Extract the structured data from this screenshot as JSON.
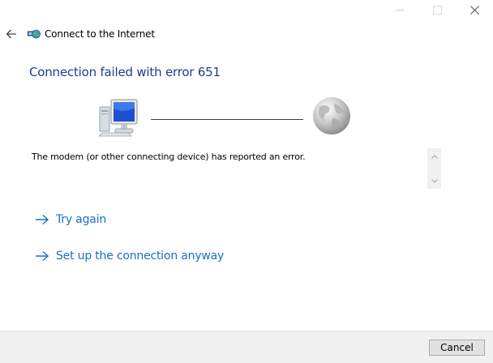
{
  "window": {
    "title": "Connect to the Internet",
    "controls": {
      "minimize": "minimize-icon",
      "maximize": "maximize-icon",
      "close": "close-icon"
    }
  },
  "header": {
    "back_icon": "back-arrow-icon",
    "app_icon": "network-globe-icon",
    "title": "Connect to the Internet"
  },
  "main": {
    "heading": "Connection failed with error 651",
    "diagram": {
      "left_icon": "computer-icon",
      "right_icon": "globe-icon"
    },
    "message": "The modem (or other connecting device) has reported an error.",
    "links": [
      {
        "label": "Try again",
        "icon": "arrow-right-icon"
      },
      {
        "label": "Set up the connection anyway",
        "icon": "arrow-right-icon"
      }
    ]
  },
  "footer": {
    "cancel_label": "Cancel"
  },
  "colors": {
    "heading": "#1e3c8c",
    "link": "#1a6fc4",
    "footer_bg": "#f0f0f0"
  }
}
